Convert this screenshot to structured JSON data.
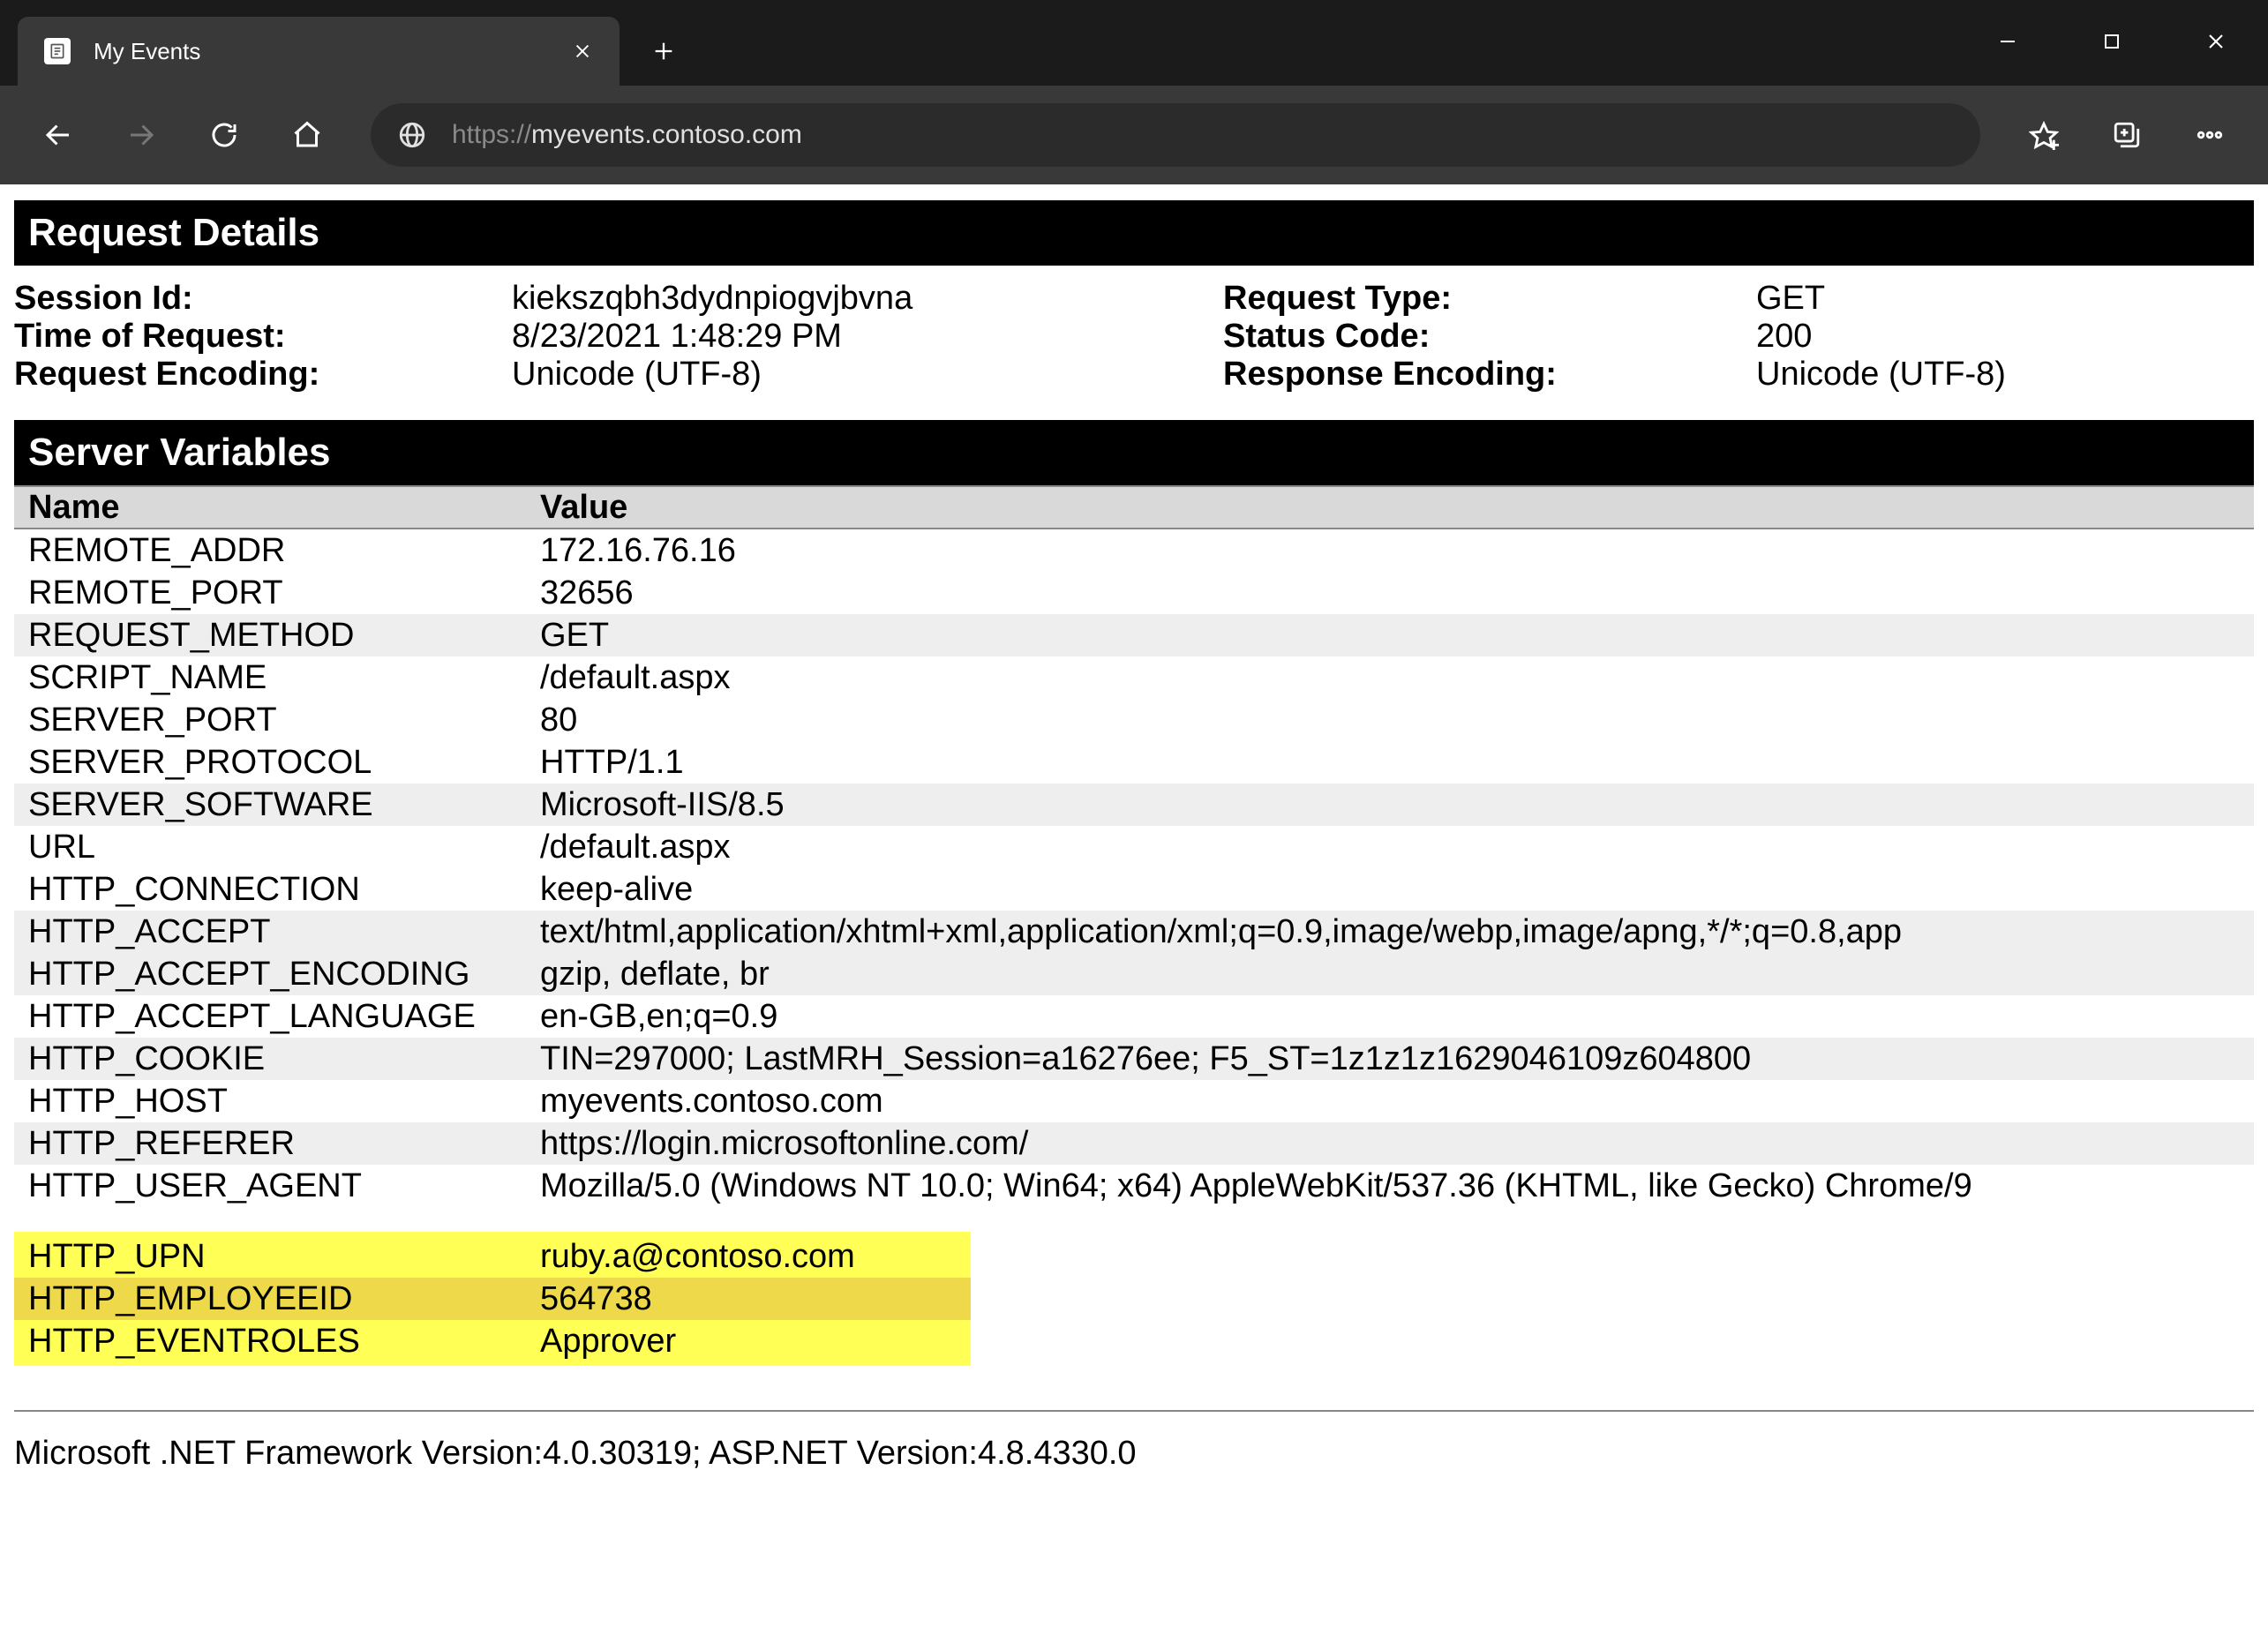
{
  "browser": {
    "tab_title": "My Events",
    "url_scheme": "https://",
    "url_host": "myevents.contoso.com"
  },
  "sections": {
    "request_details": "Request Details",
    "server_variables": "Server Variables"
  },
  "request": {
    "labels": {
      "session_id": "Session Id:",
      "time": "Time of Request:",
      "req_encoding": "Request Encoding:",
      "req_type": "Request Type:",
      "status": "Status Code:",
      "resp_encoding": "Response Encoding:"
    },
    "values": {
      "session_id": "kiekszqbh3dydnpiogvjbvna",
      "time": "8/23/2021 1:48:29 PM",
      "req_encoding": "Unicode (UTF-8)",
      "req_type": "GET",
      "status": "200",
      "resp_encoding": "Unicode (UTF-8)"
    }
  },
  "columns": {
    "name": "Name",
    "value": "Value"
  },
  "vars": [
    {
      "name": "REMOTE_ADDR",
      "value": "172.16.76.16"
    },
    {
      "name": "REMOTE_PORT",
      "value": "32656"
    },
    {
      "name": "REQUEST_METHOD",
      "value": "GET"
    },
    {
      "name": "SCRIPT_NAME",
      "value": "/default.aspx"
    },
    {
      "name": "SERVER_PORT",
      "value": "80"
    },
    {
      "name": "SERVER_PROTOCOL",
      "value": "HTTP/1.1"
    },
    {
      "name": "SERVER_SOFTWARE",
      "value": "Microsoft-IIS/8.5"
    },
    {
      "name": "URL",
      "value": "/default.aspx"
    },
    {
      "name": "HTTP_CONNECTION",
      "value": "keep-alive"
    },
    {
      "name": "HTTP_ACCEPT",
      "value": "text/html,application/xhtml+xml,application/xml;q=0.9,image/webp,image/apng,*/*;q=0.8,app"
    },
    {
      "name": "HTTP_ACCEPT_ENCODING",
      "value": "gzip, deflate, br"
    },
    {
      "name": "HTTP_ACCEPT_LANGUAGE",
      "value": "en-GB,en;q=0.9"
    },
    {
      "name": "HTTP_COOKIE",
      "value": "TIN=297000; LastMRH_Session=a16276ee; F5_ST=1z1z1z1629046109z604800"
    },
    {
      "name": "HTTP_HOST",
      "value": "myevents.contoso.com"
    },
    {
      "name": "HTTP_REFERER",
      "value": "https://login.microsoftonline.com/"
    },
    {
      "name": "HTTP_USER_AGENT",
      "value": "Mozilla/5.0 (Windows NT 10.0; Win64; x64) AppleWebKit/537.36 (KHTML, like Gecko) Chrome/9"
    }
  ],
  "highlighted_vars": [
    {
      "name": "HTTP_UPN",
      "value": "ruby.a@contoso.com"
    },
    {
      "name": "HTTP_EMPLOYEEID",
      "value": "564738"
    },
    {
      "name": "HTTP_EVENTROLES",
      "value": "Approver"
    }
  ],
  "footer": "Microsoft .NET Framework Version:4.0.30319; ASP.NET Version:4.8.4330.0"
}
